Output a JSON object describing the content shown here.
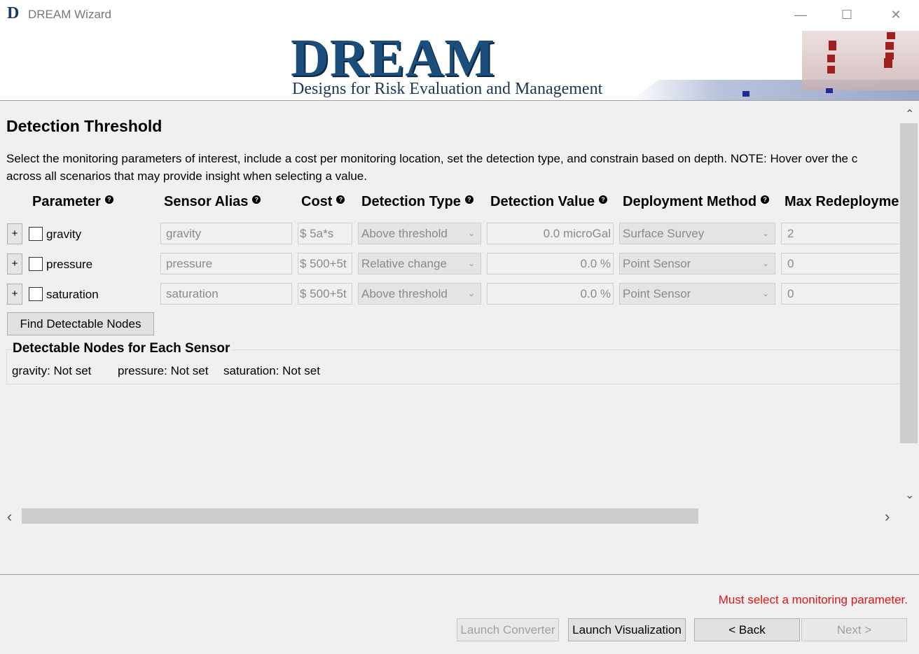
{
  "window": {
    "icon_letter": "D",
    "title": "DREAM Wizard",
    "minimize_glyph": "—",
    "maximize_glyph": "☐",
    "close_glyph": "✕"
  },
  "banner": {
    "logo_text": "DREAM",
    "subtitle": "Designs for Risk Evaluation and Management"
  },
  "page": {
    "heading": "Detection Threshold",
    "description_line1": "Select the monitoring parameters of interest, include a cost per monitoring location, set the detection type, and constrain based on depth. NOTE: Hover over the c",
    "description_line2": "across all scenarios that may provide insight when selecting a value."
  },
  "columns": {
    "parameter": "Parameter",
    "sensor_alias": "Sensor Alias",
    "cost": "Cost",
    "detection_type": "Detection Type",
    "detection_value": "Detection Value",
    "deployment_method": "Deployment Method",
    "max_redeployment": "Max Redeployme",
    "help_glyph": "?"
  },
  "rows": [
    {
      "plus": "+",
      "name": "gravity",
      "alias": "gravity",
      "cost": "$ 5a*s",
      "detection_type": "Above threshold",
      "detection_value": "0.0 microGal",
      "deployment": "Surface Survey",
      "max_redeploy": "2"
    },
    {
      "plus": "+",
      "name": "pressure",
      "alias": "pressure",
      "cost": "$ 500+5t",
      "detection_type": "Relative change",
      "detection_value": "0.0 %",
      "deployment": "Point Sensor",
      "max_redeploy": "0"
    },
    {
      "plus": "+",
      "name": "saturation",
      "alias": "saturation",
      "cost": "$ 500+5t",
      "detection_type": "Above threshold",
      "detection_value": "0.0 %",
      "deployment": "Point Sensor",
      "max_redeploy": "0"
    }
  ],
  "find_button": "Find Detectable Nodes",
  "detectable": {
    "title": "Detectable Nodes for Each Sensor",
    "items": [
      "gravity: Not set",
      "pressure: Not set",
      "saturation: Not set"
    ]
  },
  "scroll": {
    "up": "⌃",
    "down": "⌄",
    "left": "‹",
    "right": "›"
  },
  "footer": {
    "error": "Must select a monitoring parameter.",
    "launch_converter": "Launch Converter",
    "launch_visualization": "Launch Visualization",
    "back": "< Back",
    "next": "Next >"
  },
  "colors": {
    "error": "#e01414",
    "logo": "#1c4e7c"
  }
}
